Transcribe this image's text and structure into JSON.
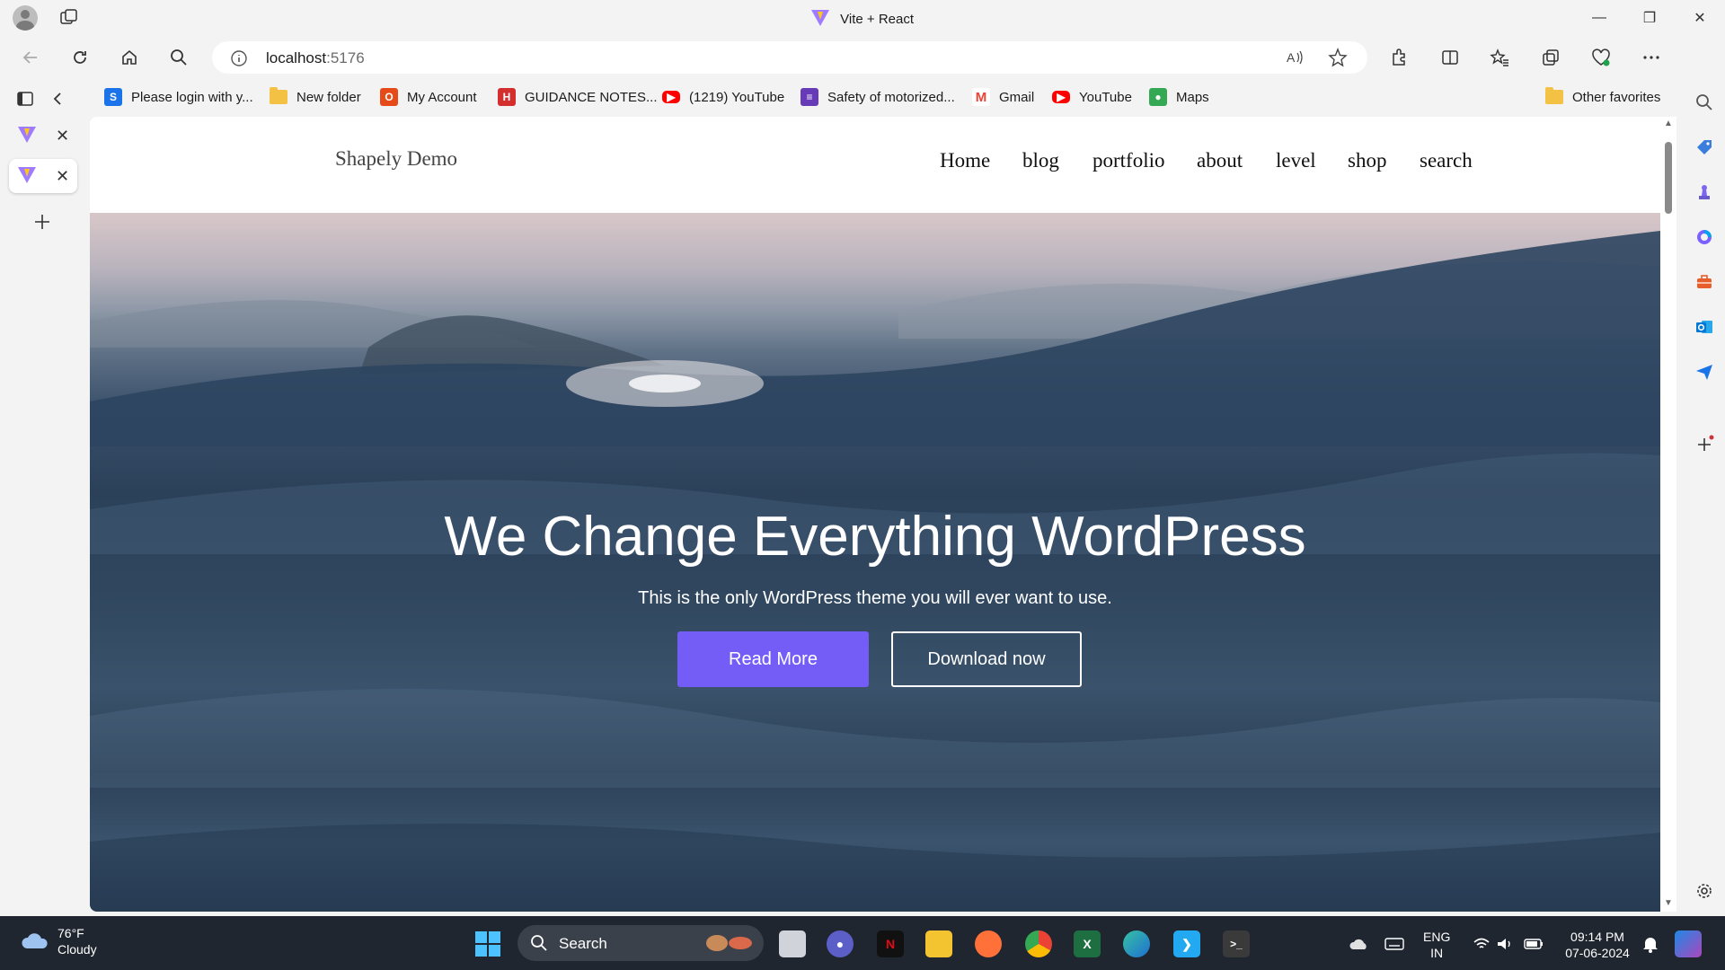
{
  "window": {
    "title": "Vite + React",
    "controls": [
      "minimize",
      "restore",
      "close"
    ]
  },
  "address_bar": {
    "host": "localhost",
    "port": ":5176"
  },
  "favorites": [
    {
      "label": "Please login with y...",
      "icon": "s-badge-icon",
      "color": "#1a73e8"
    },
    {
      "label": "New folder",
      "icon": "folder-icon",
      "color": "#f3c244"
    },
    {
      "label": "My Account",
      "icon": "office-icon",
      "color": "#e64a19"
    },
    {
      "label": "GUIDANCE NOTES...",
      "icon": "huawei-icon",
      "color": "#d32f2f"
    },
    {
      "label": "(1219) YouTube",
      "icon": "youtube-icon",
      "color": "#ff0000"
    },
    {
      "label": "Safety of motorized...",
      "icon": "forms-icon",
      "color": "#673ab7"
    },
    {
      "label": "Gmail",
      "icon": "gmail-icon",
      "color": "#ea4335"
    },
    {
      "label": "YouTube",
      "icon": "youtube-icon",
      "color": "#ff0000"
    },
    {
      "label": "Maps",
      "icon": "maps-icon",
      "color": "#34a853"
    }
  ],
  "other_favorites": "Other favorites",
  "site": {
    "title": "Shapely Demo",
    "nav": [
      "Home",
      "blog",
      "portfolio",
      "about",
      "level",
      "shop",
      "search"
    ],
    "hero": {
      "headline": "We Change Everything WordPress",
      "subtitle": "This is the only WordPress theme you will ever want to use.",
      "primary_button": "Read More",
      "secondary_button": "Download now",
      "primary_color": "#745cf7"
    }
  },
  "taskbar": {
    "weather_temp": "76°F",
    "weather_desc": "Cloudy",
    "search_label": "Search",
    "language": "ENG",
    "region": "IN",
    "time": "09:14 PM",
    "date": "07-06-2024"
  }
}
